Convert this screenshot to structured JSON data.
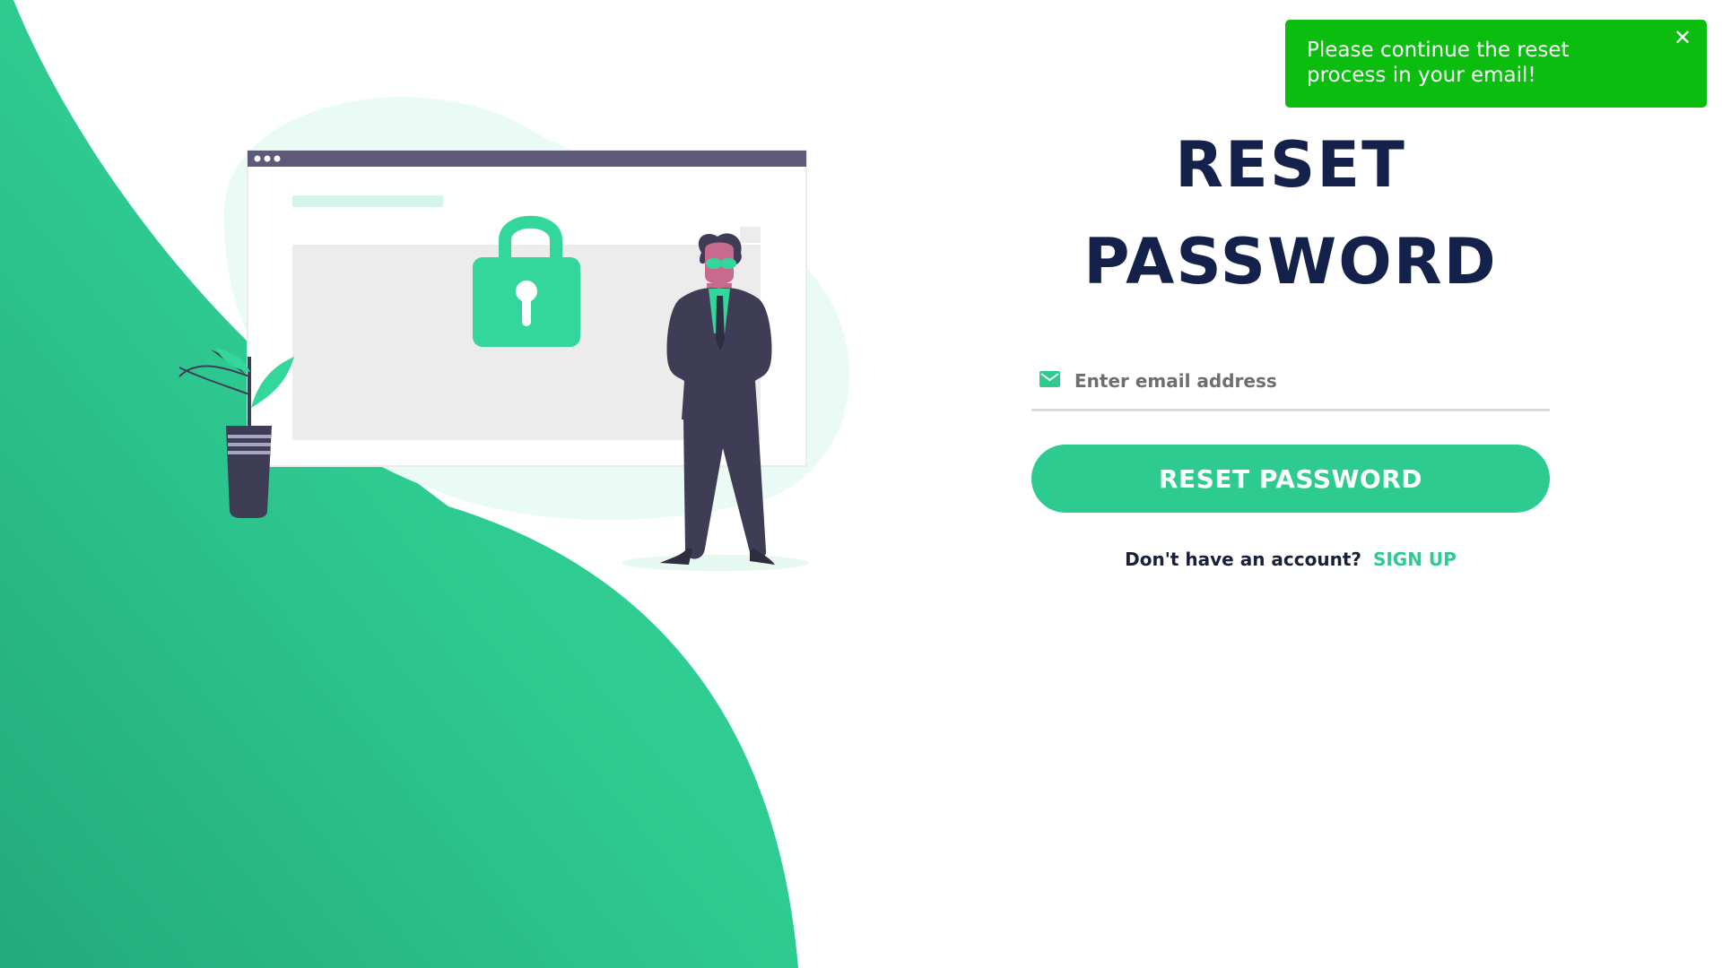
{
  "form": {
    "title_line1": "RESET",
    "title_line2": "PASSWORD",
    "email_placeholder": "Enter email address",
    "email_value": "",
    "email_icon": "mail-icon",
    "submit_label": "RESET PASSWORD",
    "signup_prompt": "Don't have an account?",
    "signup_link": "SIGN UP"
  },
  "toast": {
    "message": "Please continue the reset process in your email!",
    "close_symbol": "✕"
  },
  "colors": {
    "accent": "#2ecb91",
    "title": "#14214a",
    "toast_bg": "#0abd0f",
    "illustration_dark": "#3f3d56",
    "skin": "#c86a8e"
  }
}
